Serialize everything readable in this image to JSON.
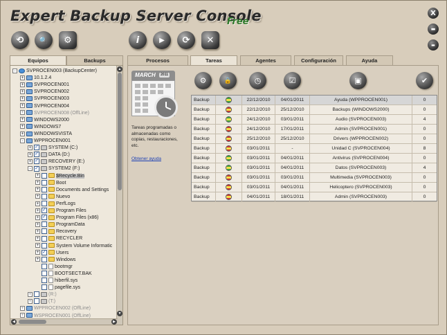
{
  "app": {
    "title": "Expert Backup Server Console",
    "edition": "Free"
  },
  "window_controls": [
    {
      "name": "close",
      "glyph": "X"
    },
    {
      "name": "maximize",
      "glyph": "▬"
    },
    {
      "name": "minimize",
      "glyph": "▬"
    }
  ],
  "toolbar": [
    {
      "name": "back",
      "glyph": "⟲"
    },
    {
      "name": "search",
      "glyph": "🔍"
    },
    {
      "name": "settings",
      "glyph": "⚙"
    },
    {
      "name": "info",
      "glyph": "i"
    },
    {
      "name": "play",
      "glyph": "▶"
    },
    {
      "name": "refresh",
      "glyph": "⟳"
    },
    {
      "name": "delete",
      "glyph": "✕"
    }
  ],
  "left_tabs": [
    "Equipos",
    "Backups"
  ],
  "tree": [
    {
      "indent": 0,
      "exp": "-",
      "chk": false,
      "icon": "net",
      "label": "SVPROCEN003 (BackupCenter)",
      "off": false
    },
    {
      "indent": 1,
      "exp": "+",
      "chk": false,
      "icon": "pc",
      "label": "10.1.2.4",
      "off": false
    },
    {
      "indent": 1,
      "exp": "+",
      "chk": false,
      "icon": "pc",
      "label": "SVPROCEN001",
      "off": false
    },
    {
      "indent": 1,
      "exp": "+",
      "chk": false,
      "icon": "pc",
      "label": "SVPROCEN002",
      "off": false
    },
    {
      "indent": 1,
      "exp": "+",
      "chk": false,
      "icon": "pc",
      "label": "SVPROCEN003",
      "off": false
    },
    {
      "indent": 1,
      "exp": "+",
      "chk": false,
      "icon": "pc",
      "label": "SVPROCEN004",
      "off": false
    },
    {
      "indent": 1,
      "exp": "+",
      "chk": false,
      "icon": "pc",
      "label": "SVPROCEN008 (OffLine)",
      "off": true
    },
    {
      "indent": 1,
      "exp": "+",
      "chk": false,
      "icon": "pc",
      "label": "WINDOWS2000",
      "off": false
    },
    {
      "indent": 1,
      "exp": "+",
      "chk": false,
      "icon": "pc",
      "label": "WINDOWS7",
      "off": false
    },
    {
      "indent": 1,
      "exp": "+",
      "chk": false,
      "icon": "pc",
      "label": "WINDOWSVISTA",
      "off": false
    },
    {
      "indent": 1,
      "exp": "-",
      "chk": false,
      "icon": "pc",
      "label": "WPPROCEN001",
      "off": false
    },
    {
      "indent": 2,
      "exp": "+",
      "chk": true,
      "icon": "drive",
      "label": "SYSTEM (C:)",
      "off": false
    },
    {
      "indent": 2,
      "exp": "+",
      "chk": true,
      "icon": "drive",
      "label": "DATA (D:)",
      "off": false
    },
    {
      "indent": 2,
      "exp": "+",
      "chk": true,
      "icon": "drive",
      "label": "RECOVERY (E:)",
      "off": false
    },
    {
      "indent": 2,
      "exp": "-",
      "chk": true,
      "icon": "drive",
      "label": "SYSTEM2 (F:)",
      "off": false
    },
    {
      "indent": 3,
      "exp": "+",
      "chk": false,
      "icon": "folder",
      "label": "$Recycle.Bin",
      "off": false,
      "sel": true
    },
    {
      "indent": 3,
      "exp": "+",
      "chk": false,
      "icon": "folder",
      "label": "Boot",
      "off": false
    },
    {
      "indent": 3,
      "exp": "+",
      "chk": false,
      "icon": "folder",
      "label": "Documents and Settings",
      "off": false
    },
    {
      "indent": 3,
      "exp": "+",
      "chk": false,
      "icon": "folder",
      "label": "Nuevo",
      "off": false
    },
    {
      "indent": 3,
      "exp": "+",
      "chk": false,
      "icon": "folder",
      "label": "PerfLogs",
      "off": false
    },
    {
      "indent": 3,
      "exp": "+",
      "chk": true,
      "icon": "folder",
      "label": "Program Files",
      "off": false
    },
    {
      "indent": 3,
      "exp": "+",
      "chk": true,
      "icon": "folder",
      "label": "Program Files (x86)",
      "off": false
    },
    {
      "indent": 3,
      "exp": "+",
      "chk": false,
      "icon": "folder",
      "label": "ProgramData",
      "off": false
    },
    {
      "indent": 3,
      "exp": "+",
      "chk": false,
      "icon": "folder",
      "label": "Recovery",
      "off": false
    },
    {
      "indent": 3,
      "exp": "+",
      "chk": false,
      "icon": "folder",
      "label": "RECYCLER",
      "off": false
    },
    {
      "indent": 3,
      "exp": "+",
      "chk": false,
      "icon": "folder",
      "label": "System Volume Informatic",
      "off": false
    },
    {
      "indent": 3,
      "exp": "+",
      "chk": true,
      "icon": "folder",
      "label": "Users",
      "off": false
    },
    {
      "indent": 3,
      "exp": "+",
      "chk": false,
      "icon": "folder",
      "label": "Windows",
      "off": false
    },
    {
      "indent": 3,
      "exp": "",
      "chk": false,
      "icon": "file",
      "label": "bootmgr",
      "off": false
    },
    {
      "indent": 3,
      "exp": "",
      "chk": false,
      "icon": "file",
      "label": "BOOTSECT.BAK",
      "off": false
    },
    {
      "indent": 3,
      "exp": "",
      "chk": false,
      "icon": "file",
      "label": "hiberfil.sys",
      "off": false
    },
    {
      "indent": 3,
      "exp": "",
      "chk": false,
      "icon": "file",
      "label": "pagefile.sys",
      "off": false
    },
    {
      "indent": 2,
      "exp": "+",
      "chk": false,
      "icon": "drive",
      "label": "(R:)",
      "off": true
    },
    {
      "indent": 2,
      "exp": "+",
      "chk": false,
      "icon": "drive",
      "label": "(T:)",
      "off": true
    },
    {
      "indent": 1,
      "exp": "+",
      "chk": false,
      "icon": "pc",
      "label": "WPPROCEN002 (OffLine)",
      "off": true
    },
    {
      "indent": 1,
      "exp": "+",
      "chk": false,
      "icon": "pc",
      "label": "WSPROCEN001 (OffLine)",
      "off": true
    }
  ],
  "right_tabs": [
    "Procesos",
    "Tareas",
    "Agentes",
    "Configuración",
    "Ayuda"
  ],
  "active_right_tab": "Tareas",
  "calendar": {
    "month": "MARCH",
    "year": "2011"
  },
  "description": "Tareas programadas o almacenadas como copias, restauraciones, etc.",
  "help_link": "Obtener ayuda",
  "task_icons": [
    {
      "name": "gears",
      "glyph": "⚙"
    },
    {
      "name": "lock",
      "glyph": "🔒"
    },
    {
      "name": "clock",
      "glyph": "◷"
    },
    {
      "name": "check-board",
      "glyph": "☑"
    },
    {
      "name": "window",
      "glyph": "▣"
    },
    {
      "name": "check",
      "glyph": "✔"
    }
  ],
  "colors": {
    "green": "#3aa53a",
    "red": "#c83030",
    "yellow": "#f5e14a"
  },
  "tasks": [
    {
      "type": "Backup",
      "flag": "green",
      "start": "22/12/2010",
      "end": "04/01/2011",
      "name": "Ayuda (WPPROCEN001)",
      "count": "0"
    },
    {
      "type": "Backup",
      "flag": "red",
      "start": "22/12/2010",
      "end": "25/12/2010",
      "name": "Backups (WINDOWS2000)",
      "count": "0"
    },
    {
      "type": "Backup",
      "flag": "green",
      "start": "24/12/2010",
      "end": "03/01/2011",
      "name": "Audio (SVPROCEN003)",
      "count": "4"
    },
    {
      "type": "Backup",
      "flag": "red",
      "start": "24/12/2010",
      "end": "17/01/2011",
      "name": "Admin (SVPROCEN001)",
      "count": "0"
    },
    {
      "type": "Backup",
      "flag": "red",
      "start": "25/12/2010",
      "end": "25/12/2010",
      "name": "Drivers (WPPROCEN002)",
      "count": "0"
    },
    {
      "type": "Backup",
      "flag": "red",
      "start": "03/01/2011",
      "end": "-",
      "name": "Unidad C (SVPROCEN004)",
      "count": "8"
    },
    {
      "type": "Backup",
      "flag": "green",
      "start": "03/01/2011",
      "end": "04/01/2011",
      "name": "Antivirus (SVPROCEN004)",
      "count": "0"
    },
    {
      "type": "Backup",
      "flag": "green",
      "start": "03/01/2011",
      "end": "04/01/2011",
      "name": "Datos (SVPROCEN003)",
      "count": "4"
    },
    {
      "type": "Backup",
      "flag": "red",
      "start": "03/01/2011",
      "end": "03/01/2011",
      "name": "Multimedia (SVPROCEN003)",
      "count": "0"
    },
    {
      "type": "Backup",
      "flag": "red",
      "start": "03/01/2011",
      "end": "04/01/2011",
      "name": "Helicoptero (SVPROCEN003)",
      "count": "0"
    },
    {
      "type": "Backup",
      "flag": "red",
      "start": "04/01/2011",
      "end": "18/01/2011",
      "name": "Admin (SVPROCEN003)",
      "count": "0"
    }
  ]
}
